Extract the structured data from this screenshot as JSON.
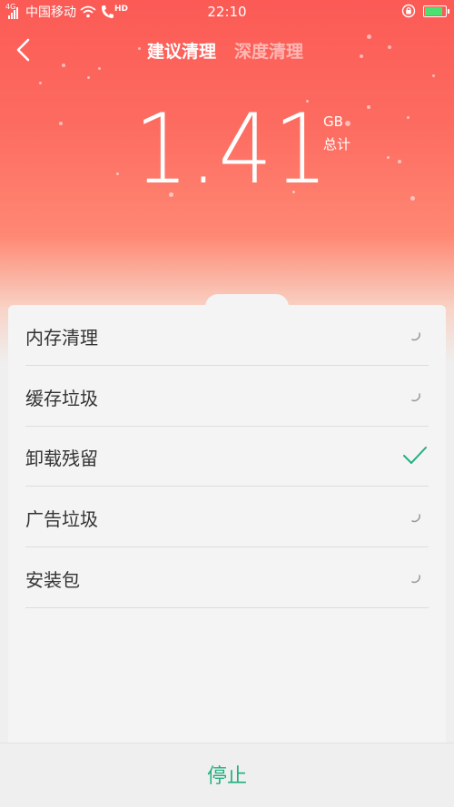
{
  "status_bar": {
    "network_type": "4G",
    "carrier": "中国移动",
    "hd_label": "HD",
    "time": "22:10",
    "battery_fill_fraction": 0.9
  },
  "nav": {
    "tabs": [
      {
        "label": "建议清理",
        "active": true
      },
      {
        "label": "深度清理",
        "active": false
      }
    ]
  },
  "summary": {
    "size_value": "1.41",
    "size_unit": "GB",
    "size_label": "总计"
  },
  "scan_items": [
    {
      "label": "内存清理",
      "status": "scanning"
    },
    {
      "label": "缓存垃圾",
      "status": "scanning"
    },
    {
      "label": "卸载残留",
      "status": "done"
    },
    {
      "label": "广告垃圾",
      "status": "scanning"
    },
    {
      "label": "安装包",
      "status": "scanning"
    }
  ],
  "footer": {
    "stop_label": "停止"
  },
  "colors": {
    "accent": "#22b07d",
    "hero_top": "#fb5a55",
    "hero_bottom": "#ff8873"
  }
}
